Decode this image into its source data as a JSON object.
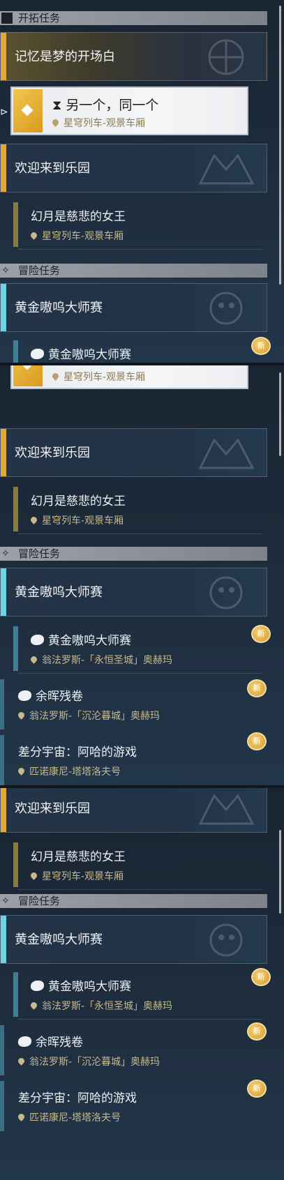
{
  "sections": {
    "main_label": "开拓任务",
    "adventure_label": "冒险任务"
  },
  "quests": {
    "memory": "记忆是梦的开场白",
    "another": {
      "title": "另一个，同一个",
      "loc": "星穹列车-观景车厢"
    },
    "welcome": "欢迎来到乐园",
    "moon": {
      "title": "幻月是慈悲的女王",
      "loc": "星穹列车-观景车厢"
    },
    "golden": "黄金嗷呜大师赛",
    "golden_sub": {
      "title": "黄金嗷呜大师赛",
      "loc": "翁法罗斯-「永恒圣城」奥赫玛"
    },
    "ember": {
      "title": "余晖残卷",
      "loc": "翁法罗斯-「沉沦暮城」奥赫玛"
    },
    "aha": {
      "title": "差分宇宙：阿哈的游戏",
      "loc": "匹诺康尼-塔塔洛夫号"
    }
  },
  "badge_new": "新",
  "colors": {
    "gold": "#e5a83b",
    "cyan": "#6fd3e6",
    "selected_bg": "#f5f6f7"
  }
}
